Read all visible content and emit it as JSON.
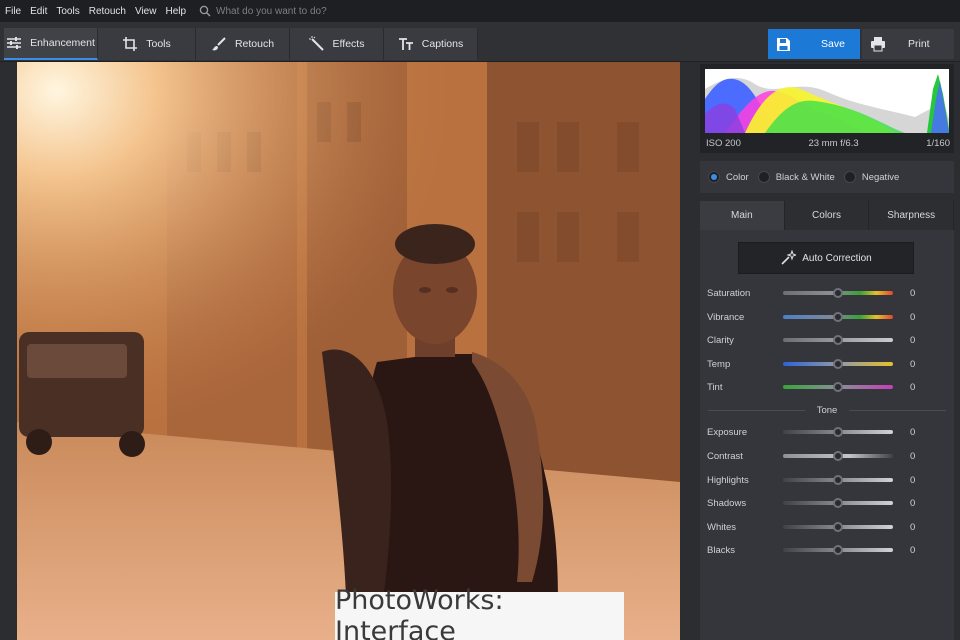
{
  "menu": {
    "items": [
      "File",
      "Edit",
      "Tools",
      "Retouch",
      "View",
      "Help"
    ],
    "search_placeholder": "What do you want to do?"
  },
  "toolbar": {
    "tabs": [
      {
        "label": "Enhancement",
        "icon": "sliders-icon",
        "active": true
      },
      {
        "label": "Tools",
        "icon": "crop-icon",
        "active": false
      },
      {
        "label": "Retouch",
        "icon": "brush-icon",
        "active": false
      },
      {
        "label": "Effects",
        "icon": "magic-wand-icon",
        "active": false
      },
      {
        "label": "Captions",
        "icon": "text-icon",
        "active": false
      }
    ],
    "save_label": "Save",
    "print_label": "Print"
  },
  "histogram": {
    "iso": "ISO 200",
    "lens": "23 mm f/6.3",
    "shutter": "1/160"
  },
  "color_mode": {
    "options": [
      "Color",
      "Black & White",
      "Negative"
    ],
    "selected": "Color"
  },
  "adjust": {
    "tabs": [
      "Main",
      "Colors",
      "Sharpness"
    ],
    "active_tab": "Main",
    "auto_label": "Auto Correction",
    "sliders": [
      {
        "label": "Saturation",
        "value": "0"
      },
      {
        "label": "Vibrance",
        "value": "0"
      },
      {
        "label": "Clarity",
        "value": "0"
      },
      {
        "label": "Temp",
        "value": "0"
      },
      {
        "label": "Tint",
        "value": "0"
      }
    ],
    "tone_label": "Tone",
    "tone_sliders": [
      {
        "label": "Exposure",
        "value": "0"
      },
      {
        "label": "Contrast",
        "value": "0"
      },
      {
        "label": "Highlights",
        "value": "0"
      },
      {
        "label": "Shadows",
        "value": "0"
      },
      {
        "label": "Whites",
        "value": "0"
      },
      {
        "label": "Blacks",
        "value": "0"
      }
    ]
  },
  "watermark": "PhotoWorks: Interface",
  "colors": {
    "accent": "#1c79d6",
    "panel_bg": "#2b2d31"
  }
}
